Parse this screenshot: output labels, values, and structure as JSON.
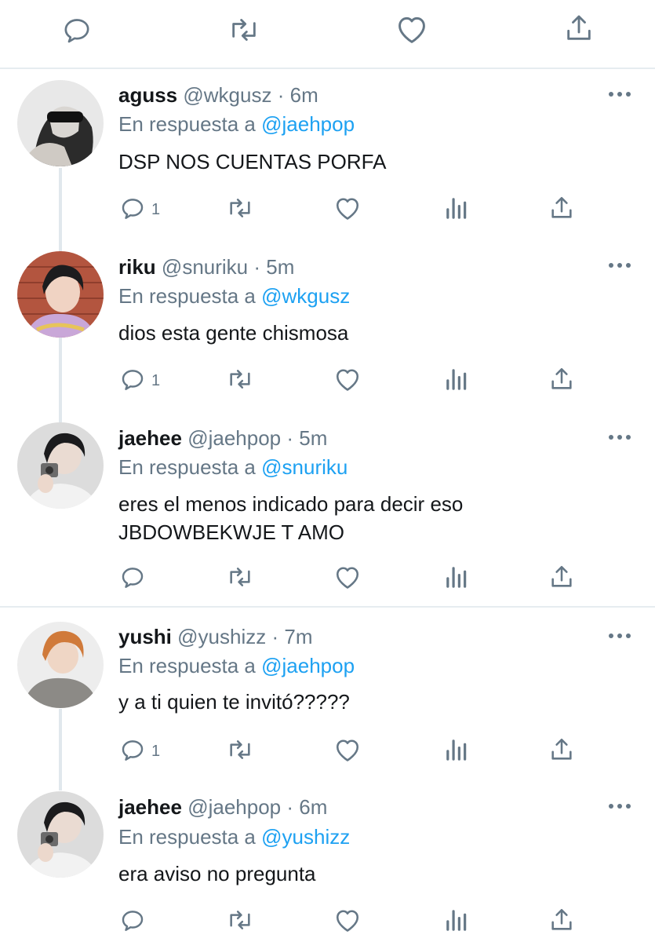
{
  "reply_prefix": "En respuesta a",
  "tweets": [
    {
      "name": "aguss",
      "handle": "@wkgusz",
      "sep": "·",
      "time": "6m",
      "reply_to": "@jaehpop",
      "text": [
        "DSP NOS CUENTAS PORFA"
      ],
      "reply_count": "1",
      "avatar": "avatar-aguss"
    },
    {
      "name": "riku",
      "handle": "@snuriku",
      "sep": "·",
      "time": "5m",
      "reply_to": "@wkgusz",
      "text": [
        "dios esta gente chismosa"
      ],
      "reply_count": "1",
      "avatar": "avatar-riku"
    },
    {
      "name": "jaehee",
      "handle": "@jaehpop",
      "sep": "·",
      "time": "5m",
      "reply_to": "@snuriku",
      "text": [
        "eres el menos indicado para decir eso",
        "JBDOWBEKWJE T AMO"
      ],
      "reply_count": "",
      "avatar": "avatar-jaehee"
    },
    {
      "name": "yushi",
      "handle": "@yushizz",
      "sep": "·",
      "time": "7m",
      "reply_to": "@jaehpop",
      "text": [
        "y a ti quien te invitó?????"
      ],
      "reply_count": "1",
      "avatar": "avatar-yushi"
    },
    {
      "name": "jaehee",
      "handle": "@jaehpop",
      "sep": "·",
      "time": "6m",
      "reply_to": "@yushizz",
      "text": [
        "era aviso no pregunta"
      ],
      "reply_count": "",
      "avatar": "avatar-jaehee"
    }
  ],
  "icons": {
    "reply": "reply-icon",
    "retweet": "retweet-icon",
    "like": "like-icon",
    "analytics": "analytics-icon",
    "share": "share-icon",
    "more": "more-icon"
  },
  "colors": {
    "icon_gray": "#657786",
    "mention_blue": "#1da1f2",
    "divider": "#e6ecf0",
    "thread_line": "#e1e8ed"
  }
}
